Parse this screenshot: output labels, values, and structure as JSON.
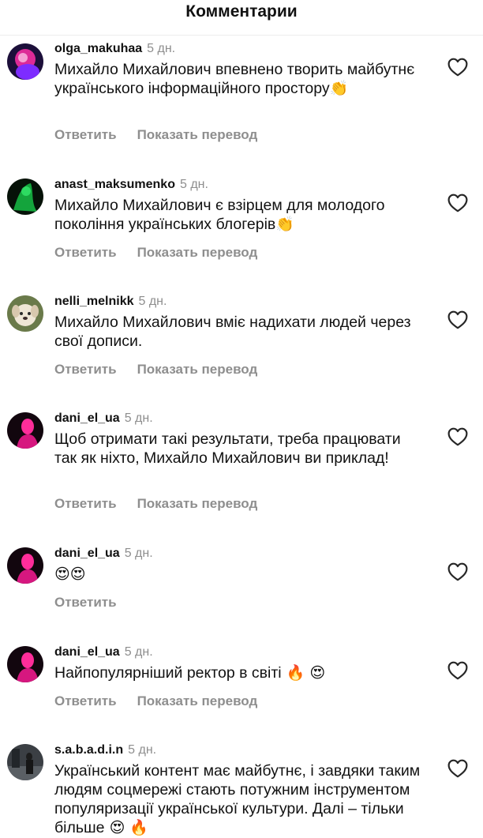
{
  "header": {
    "title": "Комментарии"
  },
  "actions": {
    "reply": "Ответить",
    "translate": "Показать перевод"
  },
  "comments": [
    {
      "username": "olga_makuhaa",
      "time": "5 дн.",
      "text": "Михайло Михайлович впевнено творить майбутнє українського інформаційного простору",
      "emoji": "👏",
      "avatar": "avatar-pink-neon"
    },
    {
      "username": "anast_maksumenko",
      "time": "5 дн.",
      "text": "Михайло Михайлович є взірцем для молодого покоління українських блогерів",
      "emoji": "👏",
      "avatar": "avatar-green-neon"
    },
    {
      "username": "nelli_melnikk",
      "time": "5 дн.",
      "text": "Михайло Михайлович вміє надихати людей через свої дописи.",
      "emoji": "",
      "avatar": "avatar-puppy"
    },
    {
      "username": "dani_el_ua",
      "time": "5 дн.",
      "text": "Щоб отримати такі результати, треба працювати так як ніхто, Михайло Михайлович ви приклад!",
      "emoji": "",
      "avatar": "avatar-magenta-figure"
    },
    {
      "username": "dani_el_ua",
      "time": "5 дн.",
      "text": "",
      "emoji": "😍😍",
      "avatar": "avatar-magenta-figure"
    },
    {
      "username": "dani_el_ua",
      "time": "5 дн.",
      "text": "Найпопулярніший ректор в світі",
      "emoji": " 🔥 😍",
      "avatar": "avatar-magenta-figure"
    },
    {
      "username": "s.a.b.a.d.i.n",
      "time": "5 дн.",
      "text": "Український контент має майбутнє, і завдяки таким людям соцмережі стають потужним інструментом популяризації української культури. Далі – тільки більше",
      "emoji": " 😍 🔥",
      "avatar": "avatar-dark-street"
    }
  ],
  "colors": {
    "secondary_text": "#8e8e8e",
    "primary_text": "#111111",
    "divider": "#ececec"
  },
  "icons": {
    "like": "heart-outline-icon"
  }
}
